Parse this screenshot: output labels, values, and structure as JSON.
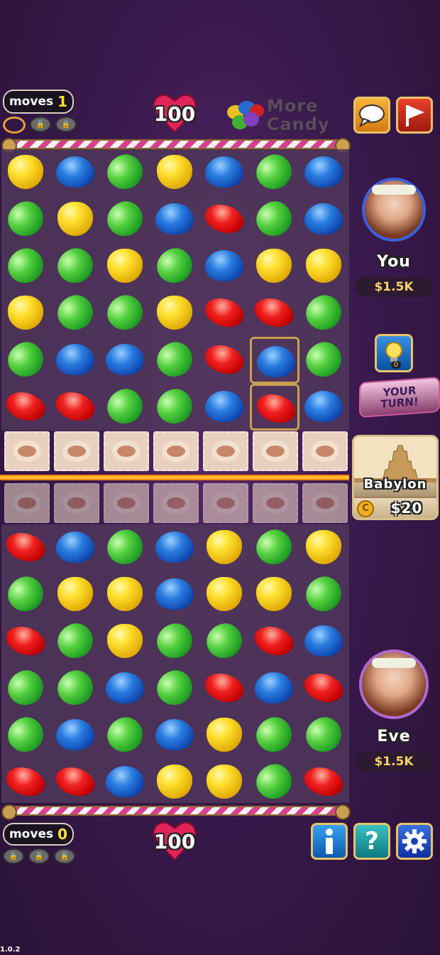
{
  "top": {
    "moves_label": "moves",
    "moves_value": "1",
    "hearts": "100",
    "more_candy": "More Candy"
  },
  "bottom": {
    "moves_label": "moves",
    "moves_value": "0",
    "hearts": "100"
  },
  "player_you": {
    "name": "You",
    "money": "$1.5K"
  },
  "player_opponent": {
    "name": "Eve",
    "money": "$1.5K"
  },
  "turn_badge": "YOUR TURN!",
  "hint_count": "0",
  "location": {
    "name": "Babylon",
    "price": "$20"
  },
  "version": "1.0.2",
  "icons": {
    "chat": "chat-bubble-icon",
    "flag": "flag-icon",
    "info": "info-icon",
    "help": "question-icon",
    "settings": "gear-icon",
    "hint": "lightbulb-icon"
  },
  "colors": {
    "accent_gold": "#e8c36a",
    "candy_yellow": "#ffe030",
    "candy_blue": "#2a7de0",
    "candy_green": "#55d040",
    "candy_red": "#f02020"
  },
  "board_top": [
    [
      "yellow",
      "blue",
      "green",
      "yellow",
      "blue",
      "green",
      "blue"
    ],
    [
      "green",
      "yellow",
      "green",
      "blue",
      "red",
      "green",
      "blue"
    ],
    [
      "green",
      "green",
      "yellow",
      "green",
      "blue",
      "yellow",
      "yellow"
    ],
    [
      "yellow",
      "green",
      "green",
      "yellow",
      "red",
      "red",
      "green"
    ],
    [
      "green",
      "blue",
      "blue",
      "green",
      "red",
      "blue",
      "green"
    ],
    [
      "red",
      "red",
      "green",
      "green",
      "blue",
      "red",
      "blue"
    ]
  ],
  "board_bottom": [
    [
      "red",
      "blue",
      "green",
      "blue",
      "yellow",
      "green",
      "yellow"
    ],
    [
      "green",
      "yellow",
      "yellow",
      "blue",
      "yellow",
      "yellow",
      "green"
    ],
    [
      "red",
      "green",
      "yellow",
      "green",
      "green",
      "red",
      "blue"
    ],
    [
      "green",
      "green",
      "blue",
      "green",
      "red",
      "blue",
      "red"
    ],
    [
      "green",
      "blue",
      "green",
      "blue",
      "yellow",
      "green",
      "green"
    ],
    [
      "red",
      "red",
      "blue",
      "yellow",
      "yellow",
      "green",
      "red"
    ]
  ],
  "selected_cells": [
    [
      4,
      5
    ],
    [
      5,
      5
    ]
  ]
}
